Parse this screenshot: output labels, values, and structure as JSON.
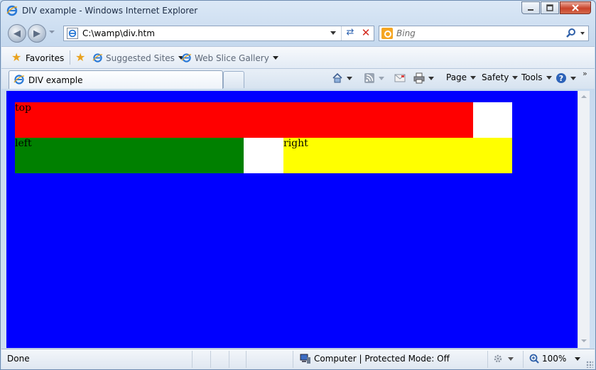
{
  "window": {
    "title": "DIV example - Windows Internet Explorer"
  },
  "nav": {
    "address": "C:\\wamp\\div.htm",
    "search_placeholder": "Bing"
  },
  "favorites_bar": {
    "favorites_label": "Favorites",
    "items": [
      {
        "label": "Suggested Sites",
        "icon": "ie-icon"
      },
      {
        "label": "Web Slice Gallery",
        "icon": "ie-icon"
      }
    ]
  },
  "tabs": [
    {
      "label": "DIV example",
      "icon": "ie-icon",
      "active": true
    }
  ],
  "command_bar": {
    "page_label": "Page",
    "safety_label": "Safety",
    "tools_label": "Tools",
    "overflow": "»"
  },
  "page": {
    "divs": {
      "top": {
        "text": "top",
        "color": "#ff0000"
      },
      "left": {
        "text": "left",
        "color": "#008000"
      },
      "right": {
        "text": "right",
        "color": "#ffff00"
      }
    },
    "background": "#0000ff"
  },
  "status": {
    "text": "Done",
    "zone": "Computer | Protected Mode: Off",
    "zoom": "100%"
  }
}
